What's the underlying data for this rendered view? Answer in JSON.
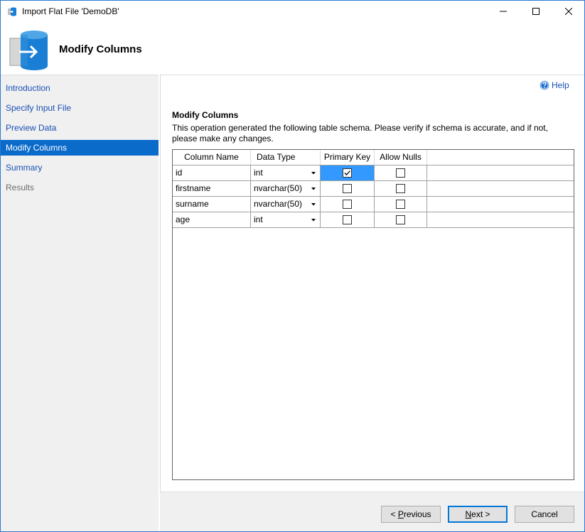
{
  "window": {
    "title": "Import Flat File 'DemoDB'"
  },
  "header": {
    "title": "Modify Columns",
    "icon": "database-import-icon"
  },
  "sidebar": {
    "items": [
      {
        "label": "Introduction",
        "state": "link"
      },
      {
        "label": "Specify Input File",
        "state": "link"
      },
      {
        "label": "Preview Data",
        "state": "link"
      },
      {
        "label": "Modify Columns",
        "state": "active"
      },
      {
        "label": "Summary",
        "state": "link"
      },
      {
        "label": "Results",
        "state": "disabled"
      }
    ]
  },
  "main": {
    "help_label": "Help",
    "section_title": "Modify Columns",
    "description": "This operation generated the following table schema. Please verify if schema is accurate, and if not, please make any changes.",
    "grid": {
      "headers": [
        "Column Name",
        "Data Type",
        "Primary Key",
        "Allow Nulls"
      ],
      "rows": [
        {
          "name": "id",
          "type": "int",
          "primary_key": true,
          "allow_nulls": false
        },
        {
          "name": "firstname",
          "type": "nvarchar(50)",
          "primary_key": false,
          "allow_nulls": false
        },
        {
          "name": "surname",
          "type": "nvarchar(50)",
          "primary_key": false,
          "allow_nulls": false
        },
        {
          "name": "age",
          "type": "int",
          "primary_key": false,
          "allow_nulls": false
        }
      ]
    }
  },
  "footer": {
    "previous_prefix": "< ",
    "previous_mnemonic": "P",
    "previous_rest": "revious",
    "next_mnemonic": "N",
    "next_rest": "ext >",
    "cancel_label": "Cancel"
  },
  "colors": {
    "accent": "#0b6bcb",
    "selection": "#3399ff",
    "link": "#1a4fb3"
  }
}
